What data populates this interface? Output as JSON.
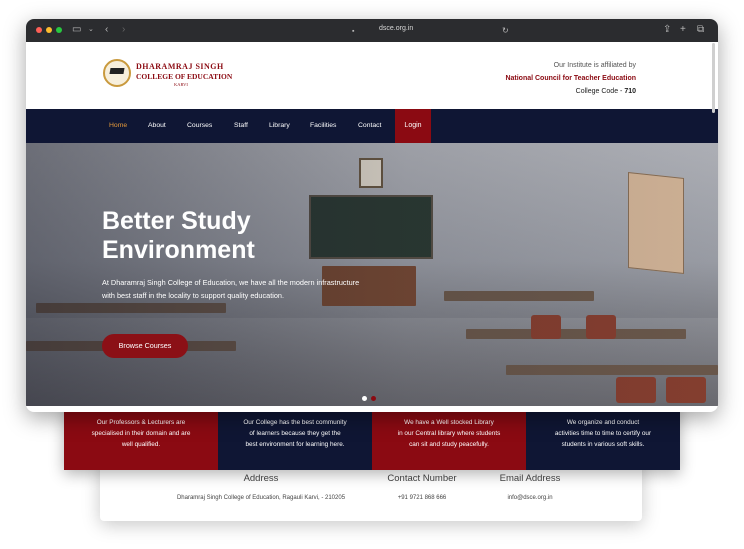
{
  "browser": {
    "address": "dsce.org.in",
    "colors": {
      "close": "#fe5f57",
      "minimize": "#febc2e",
      "maximize": "#28c840"
    },
    "icons": [
      "sidebar-icon",
      "chevron-down-icon",
      "back-icon",
      "forward-icon",
      "lock-icon",
      "reload-icon",
      "share-icon",
      "new-tab-icon",
      "tabs-overview-icon"
    ]
  },
  "header": {
    "logo_line1": "DHARAMRAJ SINGH",
    "logo_line2": "COLLEGE OF EDUCATION",
    "logo_line3": "KARVI",
    "affiliation_line": "Our Institute is affiliated by",
    "affiliation_body": "National Council for Teacher Education",
    "college_code_label": "College Code - ",
    "college_code_value": "710"
  },
  "nav": {
    "items": [
      "Home",
      "About",
      "Courses",
      "Staff",
      "Library",
      "Facilities",
      "Contact"
    ],
    "login": "Login",
    "active_index": 0
  },
  "hero": {
    "title": "Better Study Environment",
    "text": "At Dharamraj Singh College of Education, we have all the modern infrastructure with best staff in the locality to support quality education.",
    "button": "Browse Courses",
    "slide_count": 2,
    "active_slide": 0
  },
  "features": [
    {
      "line1": "Our Professors & Lecturers are",
      "line2": "specialised in their domain and are",
      "line3": "well qualified."
    },
    {
      "line1": "Our College has the best community",
      "line2": "of learners because they get the",
      "line3": "best environment for learning here."
    },
    {
      "line1": "We have a Well stocked Library",
      "line2": "in our Central library where students",
      "line3": "can sit and study peacefully."
    },
    {
      "line1": "We organize and conduct",
      "line2": "activities time to time to certify our",
      "line3": "students in various soft skills."
    }
  ],
  "contact": {
    "address_title": "Address",
    "address_value": "Dharamraj Singh College of Education, Ragauli Karvi, - 210205",
    "phone_title": "Contact Number",
    "phone_value": "+91 9721 868 666",
    "email_title": "Email Address",
    "email_value": "info@dsce.org.in"
  },
  "theme": {
    "brand_red": "#8b0a12",
    "navy": "#0f1634",
    "accent_orange": "#e69a3a"
  }
}
